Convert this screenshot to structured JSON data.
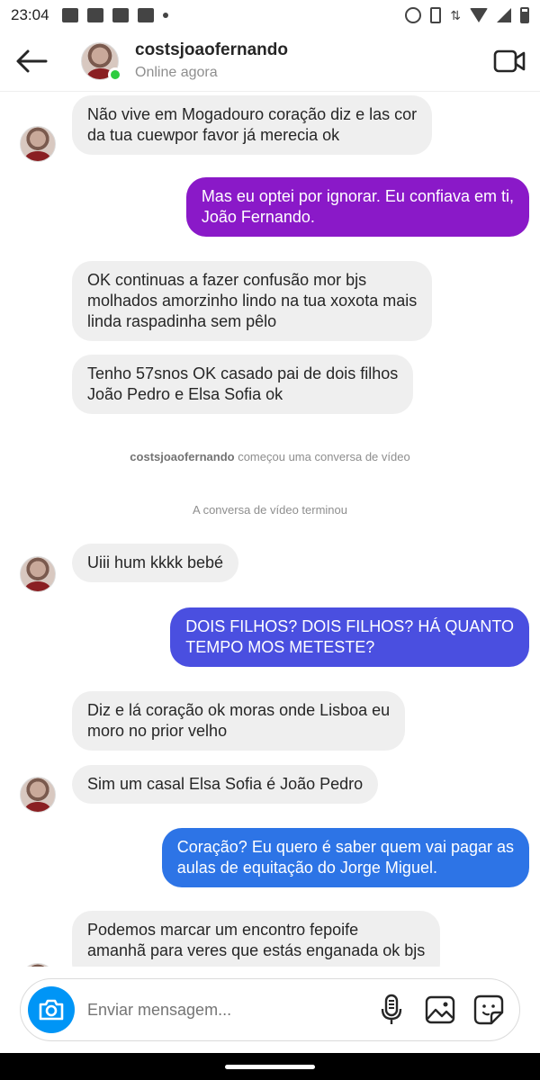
{
  "status_bar": {
    "time": "23:04"
  },
  "header": {
    "username": "costsjoaofernando",
    "status": "Online agora"
  },
  "messages": [
    {
      "dir": "in",
      "text_lines": [
        "Não vive em Mogadouro coração diz e las cor",
        "da tua cuewpor favor já merecia ok"
      ],
      "avatar": true
    },
    {
      "dir": "out",
      "text_lines": [
        "Mas eu optei por ignorar. Eu confiava em ti,",
        "João Fernando."
      ],
      "color": "#8a19c8"
    },
    {
      "dir": "in",
      "text_lines": [
        "OK continuas a fazer confusão mor bjs",
        "molhados amorzinho lindo na tua xoxota mais",
        "linda raspadinha sem pêlo"
      ]
    },
    {
      "dir": "in",
      "text_lines": [
        "Tenho 57snos OK casado pai de dois filhos",
        "João Pedro e Elsa Sofia ok"
      ]
    },
    {
      "dir": "in",
      "text_lines": [
        "Uiii hum kkkk bebé"
      ],
      "avatar": true
    },
    {
      "dir": "out",
      "text_lines": [
        "DOIS FILHOS? DOIS FILHOS? HÁ QUANTO",
        "TEMPO MOS METESTE?"
      ],
      "color": "#4a4fe0"
    },
    {
      "dir": "in",
      "text_lines": [
        "Diz e lá coração ok moras onde Lisboa eu",
        "moro no prior velho"
      ]
    },
    {
      "dir": "in",
      "text_lines": [
        "Sim um casal Elsa Sofia é João Pedro"
      ],
      "avatar": true
    },
    {
      "dir": "out",
      "text_lines": [
        "Coração? Eu quero é saber quem vai pagar as",
        "aulas de equitação do Jorge Miguel."
      ],
      "color": "#2d74e6"
    },
    {
      "dir": "in",
      "text_lines": [
        "Podemos marcar um encontro fepoife",
        "amanhã para veres que estás enganada ok bjs"
      ]
    }
  ],
  "system_messages": {
    "video_started_user": "costsjoaofernando",
    "video_started_text": " começou uma conversa de vídeo",
    "video_ended": "A conversa de vídeo terminou"
  },
  "composer": {
    "placeholder": "Enviar mensagem..."
  },
  "icons": {
    "back": "arrow-left-icon",
    "video": "video-camera-icon",
    "camera": "camera-icon",
    "mic": "microphone-icon",
    "gallery": "image-icon",
    "sticker": "sticker-icon"
  },
  "colors": {
    "accent": "#0095f6",
    "online": "#2ecc40",
    "incoming_bubble": "#efefef"
  }
}
